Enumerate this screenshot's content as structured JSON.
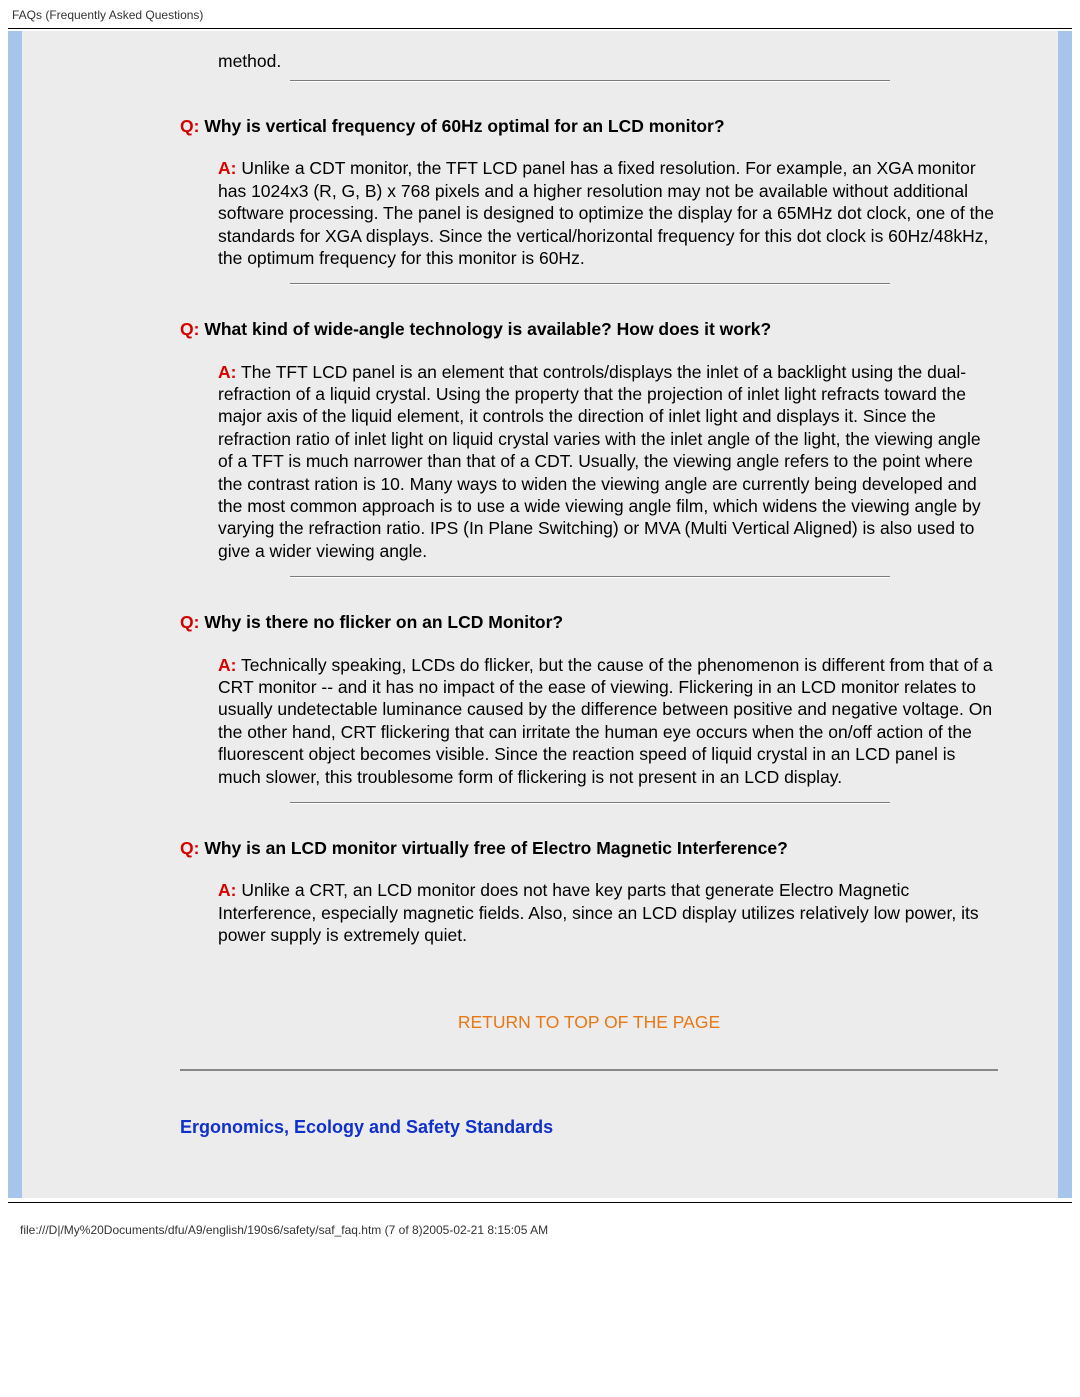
{
  "header": {
    "title": "FAQs (Frequently Asked Questions)"
  },
  "fragment_top": "method.",
  "faqs": [
    {
      "q": "Why is vertical frequency of 60Hz optimal for an LCD monitor?",
      "a": "Unlike a CDT monitor, the TFT LCD panel has a fixed resolution. For example, an XGA monitor has 1024x3 (R, G, B) x 768 pixels and a higher resolution may not be available without additional software processing. The panel is designed to optimize the display for a 65MHz dot clock, one of the standards for XGA displays. Since the vertical/horizontal frequency for this dot clock is 60Hz/48kHz, the optimum frequency for this monitor is 60Hz."
    },
    {
      "q": "What kind of wide-angle technology is available? How does it work?",
      "a": "The TFT LCD panel is an element that controls/displays the inlet of a backlight using the dual-refraction of a liquid crystal. Using the property that the projection of inlet light refracts toward the major axis of the liquid element, it controls the direction of inlet light and displays it. Since the refraction ratio of inlet light on liquid crystal varies with the inlet angle of the light, the viewing angle of a TFT is much narrower than that of a CDT. Usually, the viewing angle refers to the point where the contrast ration is 10. Many ways to widen the viewing angle are currently being developed and the most common approach is to use a wide viewing angle film, which widens the viewing angle by varying the refraction ratio. IPS (In Plane Switching) or MVA (Multi Vertical Aligned) is also used to give a wider viewing angle."
    },
    {
      "q": "Why is there no flicker on an LCD Monitor?",
      "a": "Technically speaking, LCDs do flicker, but the cause of the phenomenon is different from that of a CRT monitor -- and it has no impact of the ease of viewing. Flickering in an LCD monitor relates to usually undetectable luminance caused by the difference between positive and negative voltage. On the other hand, CRT flickering that can irritate the human eye occurs when the on/off action of the fluorescent object becomes visible. Since the reaction speed of liquid crystal in an LCD panel is much slower, this troublesome form of flickering is not present in an LCD display."
    },
    {
      "q": "Why is an LCD monitor virtually free of Electro Magnetic Interference?",
      "a": "Unlike a CRT, an LCD monitor does not have key parts that generate Electro Magnetic Interference, especially magnetic fields. Also, since an LCD display utilizes relatively low power, its power supply is extremely quiet."
    }
  ],
  "labels": {
    "q_prefix": "Q:",
    "a_prefix": "A:",
    "return_top": "RETURN TO TOP OF THE PAGE"
  },
  "section_heading": "Ergonomics, Ecology and Safety Standards",
  "footer": {
    "path": "file:///D|/My%20Documents/dfu/A9/english/190s6/safety/saf_faq.htm (7 of 8)2005-02-21 8:15:05 AM"
  }
}
